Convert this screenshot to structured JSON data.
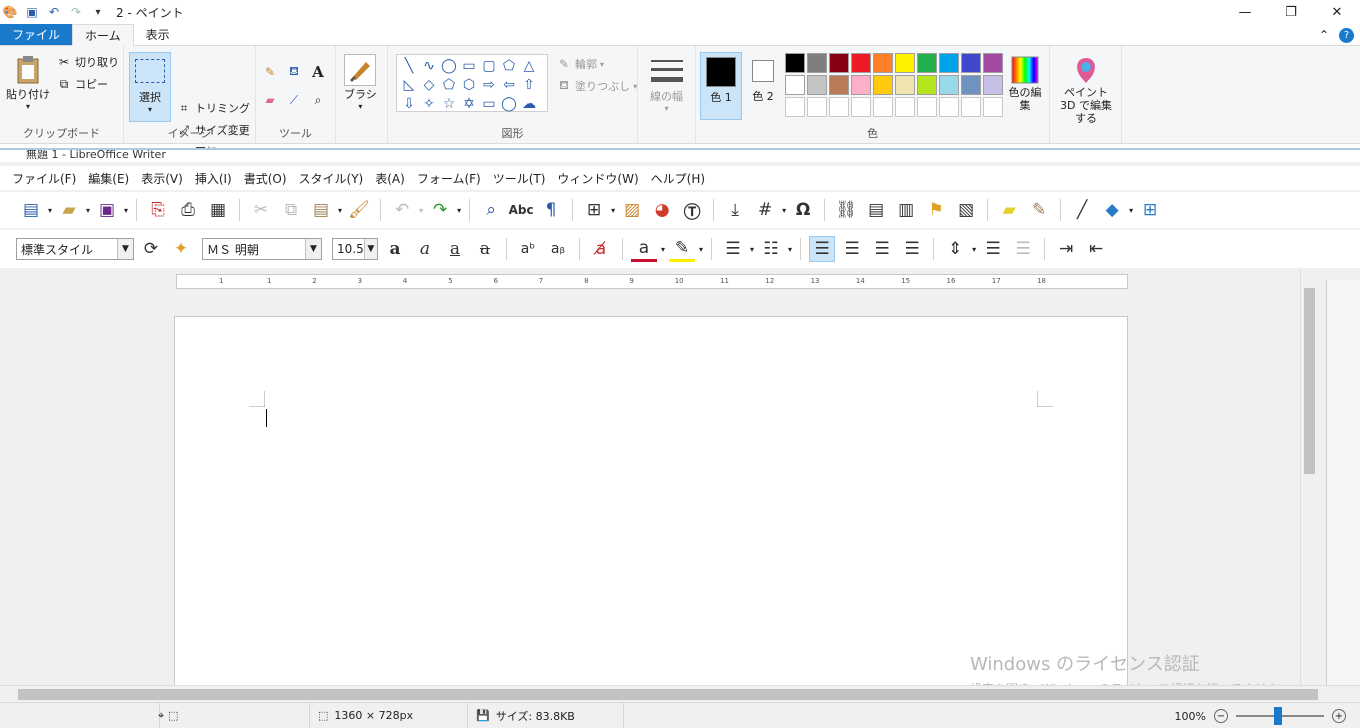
{
  "paint": {
    "window_title": "2 - ペイント",
    "tabs": {
      "file": "ファイル",
      "home": "ホーム",
      "view": "表示"
    },
    "clipboard": {
      "paste": "貼り付け",
      "cut": "切り取り",
      "copy": "コピー",
      "label": "クリップボード"
    },
    "image": {
      "select": "選択",
      "crop": "トリミング",
      "resize": "サイズ変更",
      "rotate": "回転",
      "label": "イメージ"
    },
    "tools": {
      "label": "ツール"
    },
    "brush": {
      "label": "ブラシ"
    },
    "shapes": {
      "outline": "輪郭",
      "fill": "塗りつぶし",
      "label": "図形"
    },
    "size": {
      "label": "線の幅"
    },
    "colors": {
      "color1": "色 1",
      "color2": "色 2",
      "edit": "色の編集",
      "label": "色",
      "color1_value": "#000000",
      "color2_value": "#ffffff",
      "palette_row1": [
        "#000000",
        "#7f7f7f",
        "#880015",
        "#ed1c24",
        "#ff7f27",
        "#fff200",
        "#22b14c",
        "#00a2e8",
        "#3f48cc",
        "#a349a4"
      ],
      "palette_row2": [
        "#ffffff",
        "#c3c3c3",
        "#b97a57",
        "#ffaec9",
        "#ffc90e",
        "#efe4b0",
        "#b5e61d",
        "#99d9ea",
        "#7092be",
        "#c8bfe7"
      ]
    },
    "paint3d": "ペイント 3D で編集する",
    "status": {
      "dimensions": "1360 × 728px",
      "size": "サイズ: 83.8KB",
      "zoom": "100%"
    }
  },
  "writer": {
    "title": "無題 1 - LibreOffice Writer",
    "menu": [
      "ファイル(F)",
      "編集(E)",
      "表示(V)",
      "挿入(I)",
      "書式(O)",
      "スタイル(Y)",
      "表(A)",
      "フォーム(F)",
      "ツール(T)",
      "ウィンドウ(W)",
      "ヘルプ(H)"
    ],
    "paragraph_style": "標準スタイル",
    "font_name": "ＭＳ 明朝",
    "font_size": "10.5",
    "ruler_ticks": [
      "1",
      "1",
      "2",
      "3",
      "4",
      "5",
      "6",
      "7",
      "8",
      "9",
      "10",
      "11",
      "12",
      "13",
      "14",
      "15",
      "16",
      "17",
      "18"
    ]
  },
  "watermark": {
    "line1": "Windows のライセンス認証",
    "line2": "設定を開き、Windows のライセンス認証を行ってください。"
  }
}
